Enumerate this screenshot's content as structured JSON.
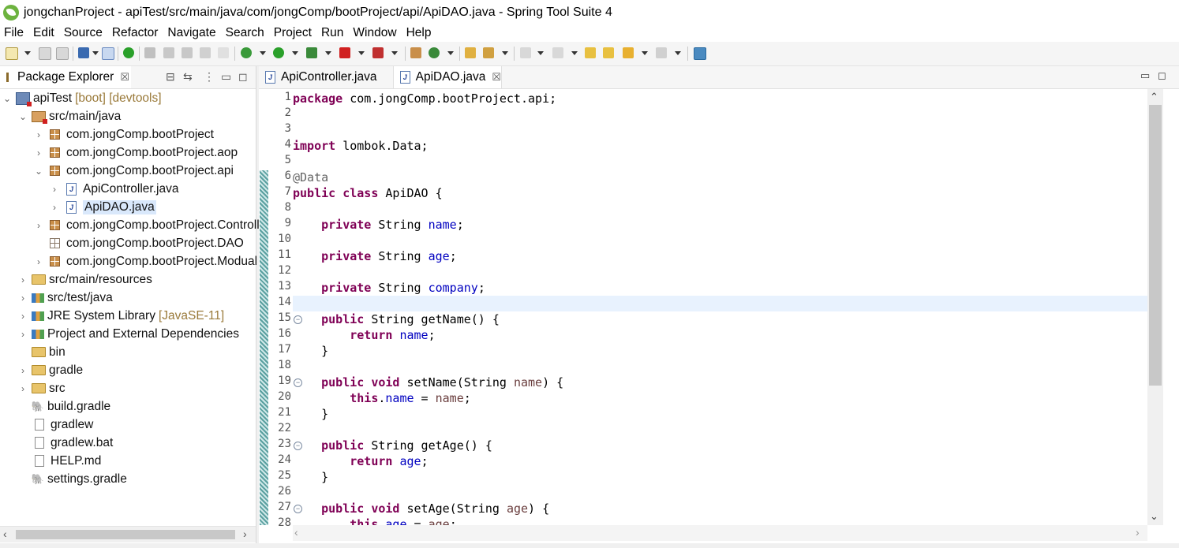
{
  "window": {
    "title": "jongchanProject - apiTest/src/main/java/com/jongComp/bootProject/api/ApiDAO.java - Spring Tool Suite 4"
  },
  "menu": [
    "File",
    "Edit",
    "Source",
    "Refactor",
    "Navigate",
    "Search",
    "Project",
    "Run",
    "Window",
    "Help"
  ],
  "package_explorer": {
    "tab_label": "Package Explorer",
    "close_glyph": "☒",
    "tree": [
      {
        "label": "apiTest",
        "decor": "[boot] [devtools]",
        "chevron": "⌄",
        "icon": "project-icon"
      },
      {
        "label": "src/main/java",
        "decor": "",
        "chevron": "⌄",
        "icon": "source-folder-icon"
      },
      {
        "label": "com.jongComp.bootProject",
        "decor": "",
        "chevron": "›",
        "icon": "package-icon"
      },
      {
        "label": "com.jongComp.bootProject.aop",
        "decor": "",
        "chevron": "›",
        "icon": "package-icon"
      },
      {
        "label": "com.jongComp.bootProject.api",
        "decor": "",
        "chevron": "⌄",
        "icon": "package-icon"
      },
      {
        "label": "ApiController.java",
        "decor": "",
        "chevron": "›",
        "icon": "java-file-icon"
      },
      {
        "label": "ApiDAO.java",
        "decor": "",
        "chevron": "›",
        "icon": "java-file-icon",
        "selected": true
      },
      {
        "label": "com.jongComp.bootProject.Controller",
        "decor": "",
        "chevron": "›",
        "icon": "package-error-icon"
      },
      {
        "label": "com.jongComp.bootProject.DAO",
        "decor": "",
        "chevron": "",
        "icon": "empty-package-icon"
      },
      {
        "label": "com.jongComp.bootProject.Modual",
        "decor": "",
        "chevron": "›",
        "icon": "package-icon"
      },
      {
        "label": "src/main/resources",
        "decor": "",
        "chevron": "›",
        "icon": "resource-folder-icon"
      },
      {
        "label": "src/test/java",
        "decor": "",
        "chevron": "›",
        "icon": "test-folder-icon"
      },
      {
        "label": "JRE System Library",
        "decor": "[JavaSE-11]",
        "chevron": "›",
        "icon": "library-icon"
      },
      {
        "label": "Project and External Dependencies",
        "decor": "",
        "chevron": "›",
        "icon": "library-icon"
      },
      {
        "label": "bin",
        "decor": "",
        "chevron": "",
        "icon": "folder-icon"
      },
      {
        "label": "gradle",
        "decor": "",
        "chevron": "›",
        "icon": "folder-icon"
      },
      {
        "label": "src",
        "decor": "",
        "chevron": "›",
        "icon": "folder-error-icon"
      },
      {
        "label": "build.gradle",
        "decor": "",
        "chevron": "",
        "icon": "gradle-icon"
      },
      {
        "label": "gradlew",
        "decor": "",
        "chevron": "",
        "icon": "file-icon"
      },
      {
        "label": "gradlew.bat",
        "decor": "",
        "chevron": "",
        "icon": "file-icon"
      },
      {
        "label": "HELP.md",
        "decor": "",
        "chevron": "",
        "icon": "markdown-file-icon"
      },
      {
        "label": "settings.gradle",
        "decor": "",
        "chevron": "",
        "icon": "gradle-icon"
      }
    ]
  },
  "editor": {
    "tabs": [
      {
        "label": "ApiController.java",
        "active": false
      },
      {
        "label": "ApiDAO.java",
        "active": true
      }
    ],
    "close_glyph": "☒",
    "lines": [
      {
        "n": "1",
        "tokens": [
          {
            "t": "package",
            "c": "kw"
          },
          {
            "t": " com.jongComp.bootProject.api;",
            "c": ""
          }
        ]
      },
      {
        "n": "2",
        "tokens": []
      },
      {
        "n": "3",
        "tokens": []
      },
      {
        "n": "4",
        "tokens": [
          {
            "t": "import",
            "c": "kw"
          },
          {
            "t": " lombok.Data;",
            "c": ""
          }
        ]
      },
      {
        "n": "5",
        "tokens": []
      },
      {
        "n": "6",
        "tokens": [
          {
            "t": "@Data",
            "c": "ann"
          }
        ]
      },
      {
        "n": "7",
        "tokens": [
          {
            "t": "public",
            "c": "kw"
          },
          {
            "t": " ",
            "c": ""
          },
          {
            "t": "class",
            "c": "kw"
          },
          {
            "t": " ApiDAO {",
            "c": ""
          }
        ]
      },
      {
        "n": "8",
        "tokens": []
      },
      {
        "n": "9",
        "tokens": [
          {
            "t": "    ",
            "c": ""
          },
          {
            "t": "private",
            "c": "kw"
          },
          {
            "t": " String ",
            "c": ""
          },
          {
            "t": "name",
            "c": "fld"
          },
          {
            "t": ";",
            "c": ""
          }
        ]
      },
      {
        "n": "10",
        "tokens": []
      },
      {
        "n": "11",
        "tokens": [
          {
            "t": "    ",
            "c": ""
          },
          {
            "t": "private",
            "c": "kw"
          },
          {
            "t": " String ",
            "c": ""
          },
          {
            "t": "age",
            "c": "fld"
          },
          {
            "t": ";",
            "c": ""
          }
        ]
      },
      {
        "n": "12",
        "tokens": []
      },
      {
        "n": "13",
        "tokens": [
          {
            "t": "    ",
            "c": ""
          },
          {
            "t": "private",
            "c": "kw"
          },
          {
            "t": " String ",
            "c": ""
          },
          {
            "t": "company",
            "c": "fld"
          },
          {
            "t": ";",
            "c": ""
          }
        ]
      },
      {
        "n": "14",
        "tokens": [],
        "current": true
      },
      {
        "n": "15",
        "fold": true,
        "tokens": [
          {
            "t": "    ",
            "c": ""
          },
          {
            "t": "public",
            "c": "kw"
          },
          {
            "t": " String getName() {",
            "c": ""
          }
        ]
      },
      {
        "n": "16",
        "tokens": [
          {
            "t": "        ",
            "c": ""
          },
          {
            "t": "return",
            "c": "kw"
          },
          {
            "t": " ",
            "c": ""
          },
          {
            "t": "name",
            "c": "fld"
          },
          {
            "t": ";",
            "c": ""
          }
        ]
      },
      {
        "n": "17",
        "tokens": [
          {
            "t": "    }",
            "c": ""
          }
        ]
      },
      {
        "n": "18",
        "tokens": []
      },
      {
        "n": "19",
        "fold": true,
        "tokens": [
          {
            "t": "    ",
            "c": ""
          },
          {
            "t": "public",
            "c": "kw"
          },
          {
            "t": " ",
            "c": ""
          },
          {
            "t": "void",
            "c": "kw"
          },
          {
            "t": " setName(String ",
            "c": ""
          },
          {
            "t": "name",
            "c": "par"
          },
          {
            "t": ") {",
            "c": ""
          }
        ]
      },
      {
        "n": "20",
        "tokens": [
          {
            "t": "        ",
            "c": ""
          },
          {
            "t": "this",
            "c": "kw"
          },
          {
            "t": ".",
            "c": ""
          },
          {
            "t": "name",
            "c": "fld"
          },
          {
            "t": " = ",
            "c": ""
          },
          {
            "t": "name",
            "c": "par"
          },
          {
            "t": ";",
            "c": ""
          }
        ]
      },
      {
        "n": "21",
        "tokens": [
          {
            "t": "    }",
            "c": ""
          }
        ]
      },
      {
        "n": "22",
        "tokens": []
      },
      {
        "n": "23",
        "fold": true,
        "tokens": [
          {
            "t": "    ",
            "c": ""
          },
          {
            "t": "public",
            "c": "kw"
          },
          {
            "t": " String getAge() {",
            "c": ""
          }
        ]
      },
      {
        "n": "24",
        "tokens": [
          {
            "t": "        ",
            "c": ""
          },
          {
            "t": "return",
            "c": "kw"
          },
          {
            "t": " ",
            "c": ""
          },
          {
            "t": "age",
            "c": "fld"
          },
          {
            "t": ";",
            "c": ""
          }
        ]
      },
      {
        "n": "25",
        "tokens": [
          {
            "t": "    }",
            "c": ""
          }
        ]
      },
      {
        "n": "26",
        "tokens": []
      },
      {
        "n": "27",
        "fold": true,
        "tokens": [
          {
            "t": "    ",
            "c": ""
          },
          {
            "t": "public",
            "c": "kw"
          },
          {
            "t": " ",
            "c": ""
          },
          {
            "t": "void",
            "c": "kw"
          },
          {
            "t": " setAge(String ",
            "c": ""
          },
          {
            "t": "age",
            "c": "par"
          },
          {
            "t": ") {",
            "c": ""
          }
        ]
      },
      {
        "n": "28",
        "tokens": [
          {
            "t": "        ",
            "c": ""
          },
          {
            "t": "this",
            "c": "kw"
          },
          {
            "t": ".",
            "c": ""
          },
          {
            "t": "age",
            "c": "fld"
          },
          {
            "t": " = ",
            "c": ""
          },
          {
            "t": "age",
            "c": "par"
          },
          {
            "t": ";",
            "c": ""
          }
        ]
      }
    ]
  },
  "colors": {
    "keyword": "#7f0055",
    "field": "#0000c0",
    "annotation": "#646464",
    "parameter": "#6a3e3e",
    "current_line": "#e8f2fe",
    "selection": "#d9e8fb",
    "decoration": "#9a7a3a"
  }
}
